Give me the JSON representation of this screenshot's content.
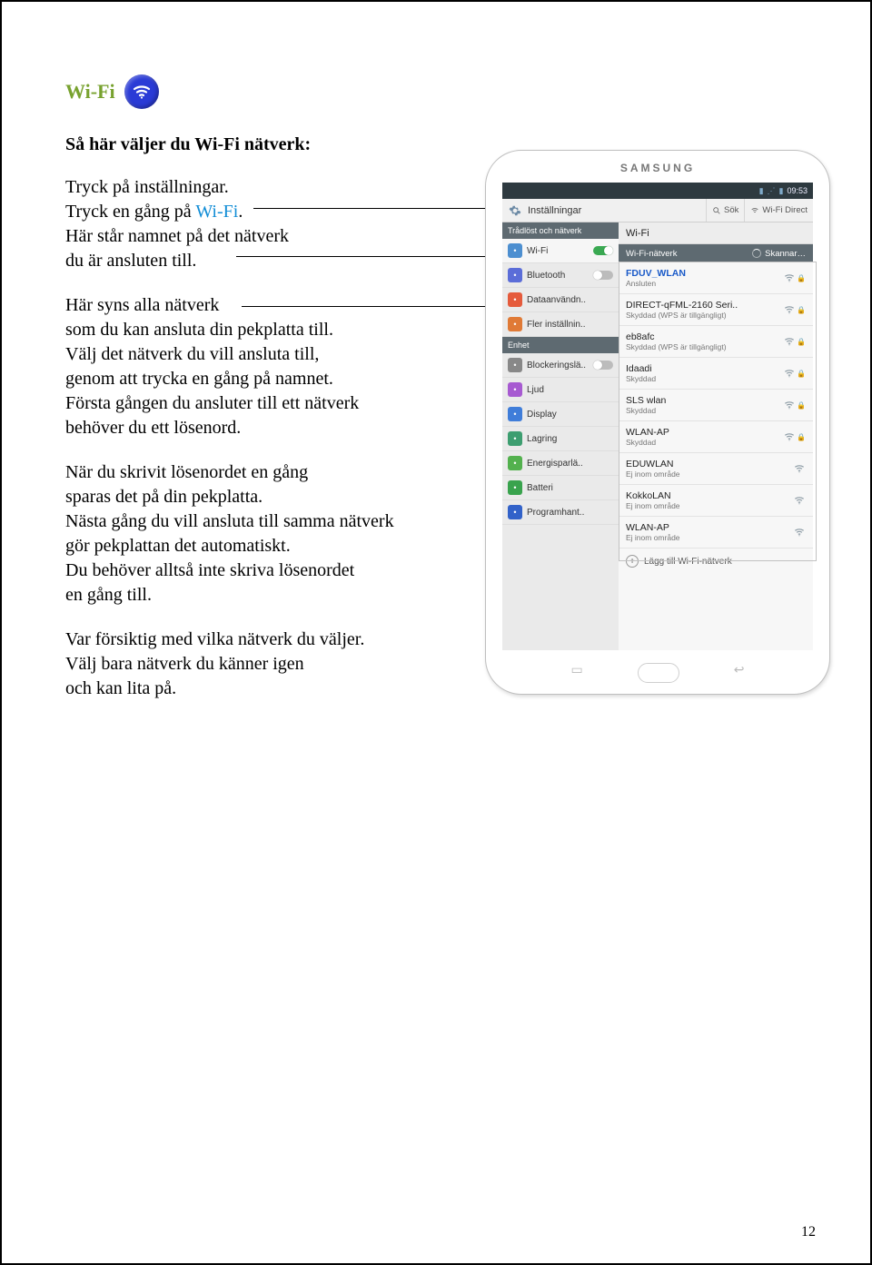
{
  "doc": {
    "title": "Wi-Fi",
    "subtitle": "Så här väljer du Wi-Fi nätverk:",
    "para1_pre": "Tryck på inställningar.\nTryck en gång på ",
    "para1_link": "Wi-Fi",
    "para1_post": ".\nHär står namnet på det nätverk\ndu är ansluten till.",
    "para2": "Här syns alla nätverk\nsom du kan ansluta din pekplatta till.\nVälj det nätverk du vill ansluta till,\ngenom att trycka en gång på namnet.\nFörsta gången du ansluter till ett nätverk\nbehöver du ett lösenord.",
    "para3": "När du skrivit lösenordet en gång\nsparas det på din pekplatta.\nNästa gång du vill ansluta till samma nätverk\ngör pekplattan det automatiskt.\nDu behöver alltså inte skriva lösenordet\nen gång till.",
    "para4": "Var försiktig med vilka nätverk du väljer.\nVälj bara nätverk du känner igen\noch kan lita på.",
    "page_number": "12"
  },
  "device": {
    "brand": "SAMSUNG",
    "status_time": "09:53",
    "header_title": "Inställningar",
    "header_search": "Sök",
    "header_wifidirect": "Wi-Fi Direct",
    "section1": "Trådlöst och nätverk",
    "section2": "Enhet",
    "left_items": [
      {
        "label": "Wi-Fi",
        "icon": "wifi",
        "switch": "on"
      },
      {
        "label": "Bluetooth",
        "icon": "bt",
        "switch": "off"
      },
      {
        "label": "Dataanvändn..",
        "icon": "data"
      },
      {
        "label": "Fler inställnin..",
        "icon": "more"
      }
    ],
    "left_items2": [
      {
        "label": "Blockeringslä..",
        "icon": "block",
        "switch": "off"
      },
      {
        "label": "Ljud",
        "icon": "sound"
      },
      {
        "label": "Display",
        "icon": "disp"
      },
      {
        "label": "Lagring",
        "icon": "stor"
      },
      {
        "label": "Energisparlä..",
        "icon": "power"
      },
      {
        "label": "Batteri",
        "icon": "batt"
      },
      {
        "label": "Programhant..",
        "icon": "prog"
      }
    ],
    "right_title": "Wi-Fi",
    "right_sub": "Wi-Fi-nätverk",
    "right_scan": "Skannar…",
    "networks": [
      {
        "name": "FDUV_WLAN",
        "sub": "Ansluten",
        "connected": true,
        "lock": true
      },
      {
        "name": "DIRECT-qFML-2160 Seri..",
        "sub": "Skyddad (WPS är tillgängligt)",
        "lock": true
      },
      {
        "name": "eb8afc",
        "sub": "Skyddad (WPS är tillgängligt)",
        "lock": true
      },
      {
        "name": "Idaadi",
        "sub": "Skyddad",
        "lock": true
      },
      {
        "name": "SLS wlan",
        "sub": "Skyddad",
        "lock": true
      },
      {
        "name": "WLAN-AP",
        "sub": "Skyddad",
        "lock": true
      },
      {
        "name": "EDUWLAN",
        "sub": "Ej inom område"
      },
      {
        "name": "KokkoLAN",
        "sub": "Ej inom område"
      },
      {
        "name": "WLAN-AP",
        "sub": "Ej inom område"
      }
    ],
    "add_network": "Lägg till Wi-Fi-nätverk"
  }
}
